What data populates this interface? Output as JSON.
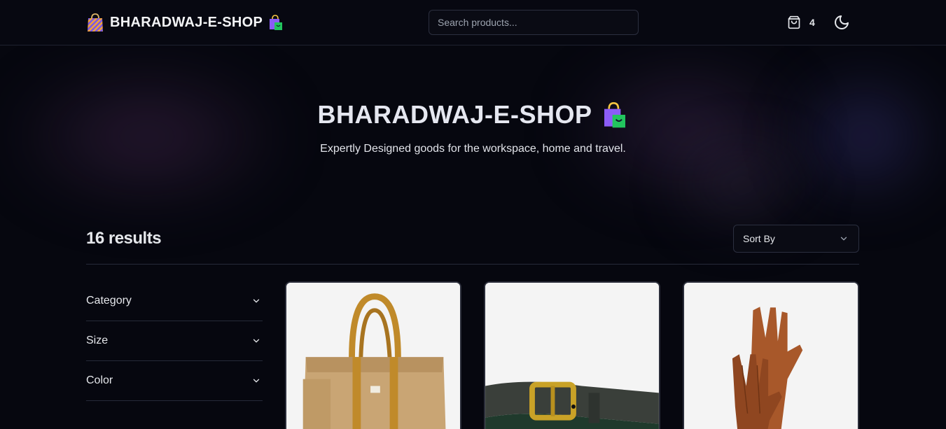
{
  "header": {
    "brand_name": "BHARADWAJ-E-SHOP",
    "search_placeholder": "Search products...",
    "cart_count": "4"
  },
  "hero": {
    "title": "BHARADWAJ-E-SHOP",
    "subtitle": "Expertly Designed goods for the workspace, home and travel."
  },
  "results": {
    "count_label": "16 results",
    "sort_label": "Sort By"
  },
  "filters": [
    {
      "label": "Category"
    },
    {
      "label": "Size"
    },
    {
      "label": "Color"
    }
  ],
  "products": [
    {
      "icon": "tote-bag-image"
    },
    {
      "icon": "leather-belt-image"
    },
    {
      "icon": "leather-gloves-image"
    }
  ],
  "colors": {
    "background": "#06070f",
    "border": "#262a39",
    "text": "#e5e7eb",
    "card_bg": "#f4f4f4"
  }
}
